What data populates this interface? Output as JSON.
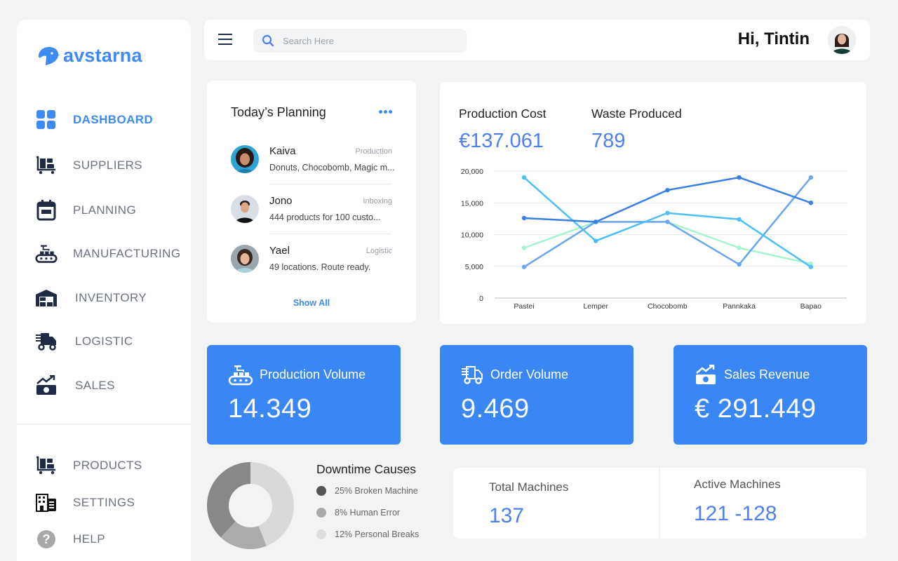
{
  "brand": {
    "name": "avstarna",
    "accent": "#3d8bf2"
  },
  "sidebar": {
    "items": [
      {
        "label": "DASHBOARD",
        "icon": "dashboard-grid-icon",
        "active": true
      },
      {
        "label": "SUPPLIERS",
        "icon": "cart-boxes-icon"
      },
      {
        "label": "PLANNING",
        "icon": "calendar-icon"
      },
      {
        "label": "MANUFACTURING",
        "icon": "conveyor-icon"
      },
      {
        "label": "INVENTORY",
        "icon": "warehouse-icon"
      },
      {
        "label": "LOGISTIC",
        "icon": "delivery-truck-icon"
      },
      {
        "label": "SALES",
        "icon": "money-growth-icon"
      }
    ],
    "bottom_items": [
      {
        "label": "PRODUCTS",
        "icon": "cart-boxes-icon"
      },
      {
        "label": "SETTINGS",
        "icon": "building-icon"
      },
      {
        "label": "HELP",
        "icon": "help-circle-icon"
      }
    ]
  },
  "header": {
    "search_placeholder": "Search Here",
    "search_value": "",
    "greeting": "Hi, Tintin"
  },
  "planning": {
    "title": "Today’s Planning",
    "show_all": "Show All",
    "items": [
      {
        "name": "Kaiva",
        "tag": "Production",
        "desc": "Donuts, Chocobomb, Magic m..."
      },
      {
        "name": "Jono",
        "tag": "Inboxing",
        "desc": "444 products for 100 custo..."
      },
      {
        "name": "Yael",
        "tag": "Logistic",
        "desc": "49 locations. Route ready."
      }
    ]
  },
  "kpis": {
    "production_cost": {
      "label": "Production Cost",
      "value": "€137.061"
    },
    "waste_produced": {
      "label": "Waste Produced",
      "value": "789"
    }
  },
  "chart_data": {
    "type": "line",
    "title": "",
    "xlabel": "",
    "ylabel": "",
    "categories": [
      "Pastei",
      "Lemper",
      "Chocobomb",
      "Pannkaka",
      "Bapao"
    ],
    "yticks": [
      "0",
      "5,000",
      "10,000",
      "15,000",
      "20,000"
    ],
    "ylim": [
      0,
      20000
    ],
    "grid": true,
    "legend": "none",
    "series": [
      {
        "name": "series-1",
        "color": "#a7f3d0",
        "values": [
          7900,
          12000,
          12000,
          7900,
          5400
        ]
      },
      {
        "name": "series-2",
        "color": "#6aa5f0",
        "values": [
          4900,
          12000,
          12000,
          5300,
          19000
        ]
      },
      {
        "name": "series-3",
        "color": "#4cc0f5",
        "values": [
          19000,
          9000,
          13400,
          12400,
          4900
        ]
      },
      {
        "name": "series-4",
        "color": "#3b7fe6",
        "values": [
          12600,
          12000,
          17000,
          19000,
          15000
        ]
      }
    ]
  },
  "stats": [
    {
      "label": "Production Volume",
      "value": "14.349",
      "icon": "conveyor-icon"
    },
    {
      "label": "Order Volume",
      "value": "9.469",
      "icon": "delivery-truck-icon"
    },
    {
      "label": "Sales Revenue",
      "value": "€ 291.449",
      "icon": "money-growth-icon"
    }
  ],
  "downtime": {
    "title": "Downtime Causes",
    "legend": [
      {
        "label": "25% Broken Machine",
        "color": "#555555"
      },
      {
        "label": "8% Human Error",
        "color": "#aaaaaa"
      },
      {
        "label": "12% Personal Breaks",
        "color": "#dddddd"
      }
    ],
    "donut_segments": [
      {
        "name": "personal-breaks",
        "share": 0.44,
        "color": "#d9d9d9"
      },
      {
        "name": "human-error",
        "share": 0.18,
        "color": "#ababab"
      },
      {
        "name": "broken-machine",
        "share": 0.38,
        "color": "#888888"
      }
    ]
  },
  "machines": {
    "total": {
      "label": "Total Machines",
      "value": "137"
    },
    "active": {
      "label": "Active Machines",
      "value": "121 -128"
    }
  }
}
